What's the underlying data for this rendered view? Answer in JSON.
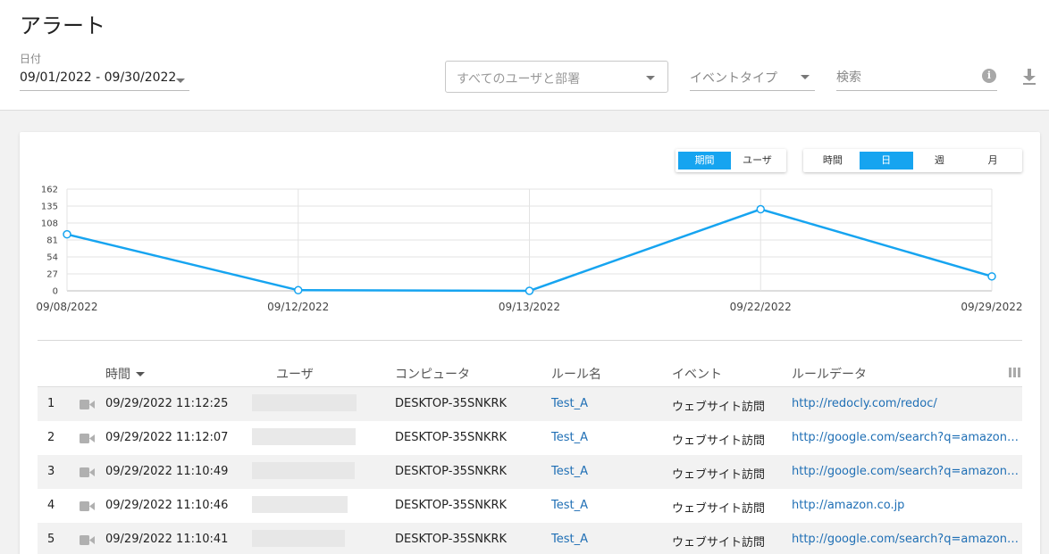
{
  "header": {
    "title": "アラート",
    "date_label": "日付",
    "date_range": "09/01/2022 - 09/30/2022",
    "user_placeholder": "すべてのユーザと部署",
    "event_placeholder": "イベントタイプ",
    "search_placeholder": "検索",
    "info_glyph": "i"
  },
  "toggles": {
    "mode": [
      {
        "label": "期間",
        "active": true
      },
      {
        "label": "ユーザ",
        "active": false
      }
    ],
    "unit": [
      {
        "label": "時間",
        "active": false
      },
      {
        "label": "日",
        "active": true
      },
      {
        "label": "週",
        "active": false
      },
      {
        "label": "月",
        "active": false
      }
    ]
  },
  "colors": {
    "accent": "#16a4f0",
    "link": "#1f6fb5",
    "grid": "#e3e3e3"
  },
  "chart_data": {
    "type": "line",
    "categories": [
      "09/08/2022",
      "09/12/2022",
      "09/13/2022",
      "09/22/2022",
      "09/29/2022"
    ],
    "series": [
      {
        "values": [
          90,
          1,
          0,
          130,
          23
        ]
      }
    ],
    "yticks": [
      0,
      27,
      54,
      81,
      108,
      135,
      162
    ],
    "ylim": [
      0,
      162
    ],
    "grid": true,
    "xlabel": "",
    "ylabel": ""
  },
  "table": {
    "columns": {
      "time": "時間",
      "user": "ユーザ",
      "computer": "コンピュータ",
      "rule": "ルール名",
      "event": "イベント",
      "rule_data": "ルールデータ"
    },
    "rows": [
      {
        "num": "1",
        "time": "09/29/2022 11:12:25",
        "computer": "DESKTOP-35SNKRK",
        "rule": "Test_A",
        "event": "ウェブサイト訪問",
        "rule_data": "http://redocly.com/redoc/"
      },
      {
        "num": "2",
        "time": "09/29/2022 11:12:07",
        "computer": "DESKTOP-35SNKRK",
        "rule": "Test_A",
        "event": "ウェブサイト訪問",
        "rule_data": "http://google.com/search?q=amazon&o..."
      },
      {
        "num": "3",
        "time": "09/29/2022 11:10:49",
        "computer": "DESKTOP-35SNKRK",
        "rule": "Test_A",
        "event": "ウェブサイト訪問",
        "rule_data": "http://google.com/search?q=amazon&o..."
      },
      {
        "num": "4",
        "time": "09/29/2022 11:10:46",
        "computer": "DESKTOP-35SNKRK",
        "rule": "Test_A",
        "event": "ウェブサイト訪問",
        "rule_data": "http://amazon.co.jp"
      },
      {
        "num": "5",
        "time": "09/29/2022 11:10:41",
        "computer": "DESKTOP-35SNKRK",
        "rule": "Test_A",
        "event": "ウェブサイト訪問",
        "rule_data": "http://google.com/search?q=amazon&o..."
      }
    ]
  }
}
